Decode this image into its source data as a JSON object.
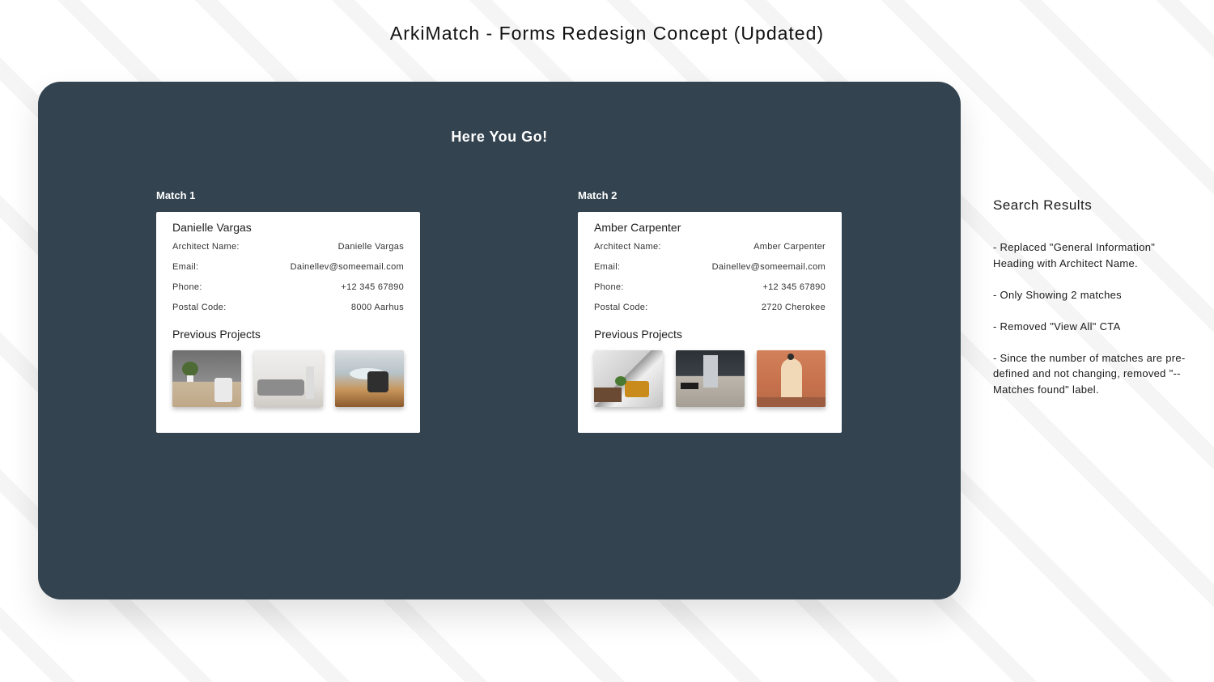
{
  "page_title": "ArkiMatch - Forms Redesign Concept (Updated)",
  "panel": {
    "heading": "Here You Go!",
    "matches": [
      {
        "label": "Match 1",
        "name": "Danielle Vargas",
        "fields": [
          {
            "label": "Architect Name:",
            "value": "Danielle Vargas"
          },
          {
            "label": "Email:",
            "value": "Dainellev@someemail.com"
          },
          {
            "label": "Phone:",
            "value": "+12 345 67890"
          },
          {
            "label": "Postal Code:",
            "value": "8000 Aarhus"
          }
        ],
        "projects_title": "Previous Projects"
      },
      {
        "label": "Match 2",
        "name": "Amber Carpenter",
        "fields": [
          {
            "label": "Architect Name:",
            "value": "Amber Carpenter"
          },
          {
            "label": "Email:",
            "value": "Dainellev@someemail.com"
          },
          {
            "label": "Phone:",
            "value": "+12 345 67890"
          },
          {
            "label": "Postal Code:",
            "value": "2720 Cherokee"
          }
        ],
        "projects_title": "Previous Projects"
      }
    ]
  },
  "side_notes": {
    "title": "Search Results",
    "notes": [
      "- Replaced \"General Information\" Heading with Architect Name.",
      "- Only Showing 2 matches",
      "- Removed \"View All\" CTA",
      "- Since the number of matches are pre-defined and not changing, removed \"-- Matches found\" label."
    ]
  },
  "colors": {
    "panel_background": "#33434f",
    "card_background": "#ffffff"
  }
}
